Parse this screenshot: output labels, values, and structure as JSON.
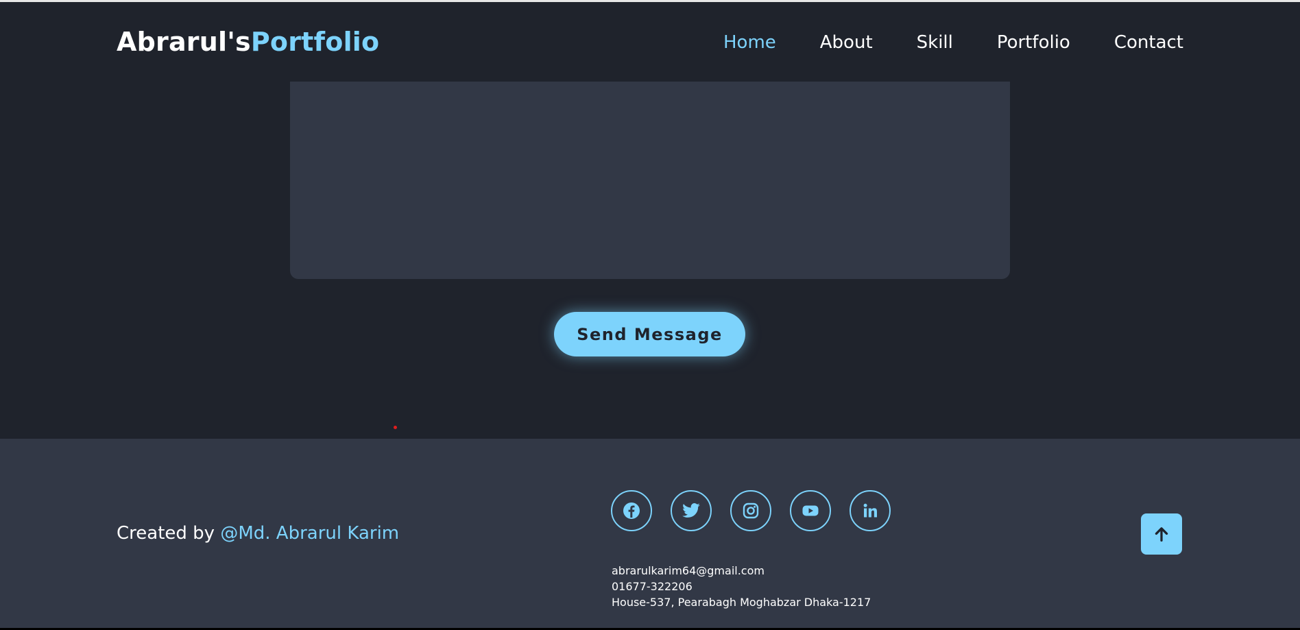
{
  "header": {
    "logo_main": "Abrarul's",
    "logo_accent": "Portfolio",
    "nav": [
      {
        "label": "Home",
        "active": true
      },
      {
        "label": "About",
        "active": false
      },
      {
        "label": "Skill",
        "active": false
      },
      {
        "label": "Portfolio",
        "active": false
      },
      {
        "label": "Contact",
        "active": false
      }
    ]
  },
  "contact_form": {
    "message_value": "",
    "send_label": "Send Message"
  },
  "footer": {
    "credit_prefix": "Created by ",
    "credit_author": "@Md. Abrarul Karim",
    "socials": [
      "facebook-icon",
      "twitter-icon",
      "instagram-icon",
      "youtube-icon",
      "linkedin-icon"
    ],
    "email": "abrarulkarim64@gmail.com",
    "phone": "01677-322206",
    "address": "House-537, Pearabagh Moghabzar Dhaka-1217",
    "scroll_top_icon": "arrow-up-icon"
  },
  "colors": {
    "background": "#1f232c",
    "surface": "#323846",
    "accent": "#7dd3fc",
    "text": "#ffffff"
  }
}
